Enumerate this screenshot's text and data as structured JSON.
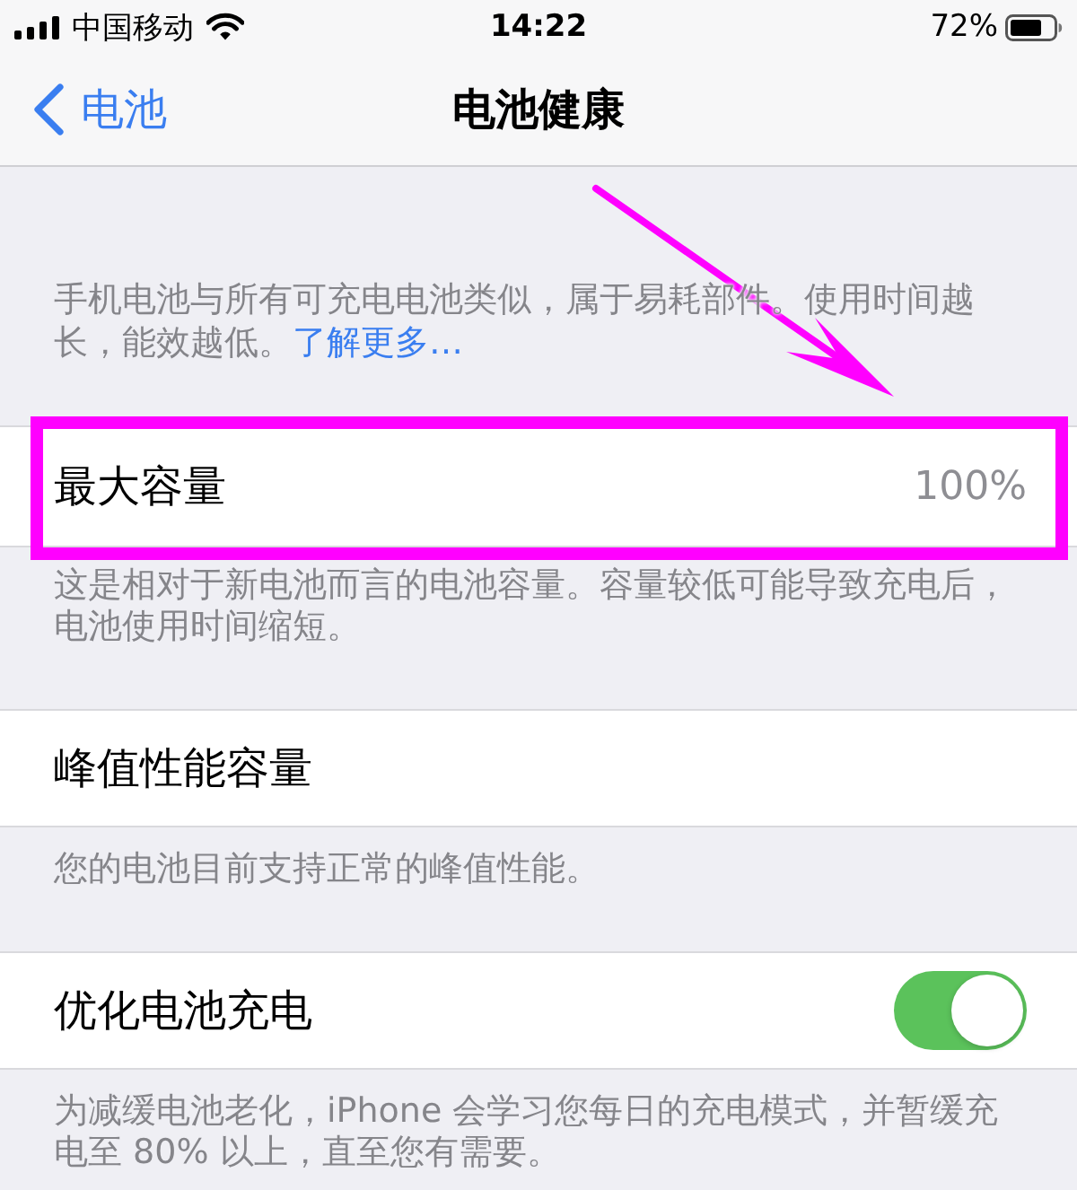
{
  "status_bar": {
    "carrier": "中国移动",
    "time": "14:22",
    "battery": "72%"
  },
  "nav_bar": {
    "back": "电池",
    "title": "电池健康"
  },
  "intro": {
    "text": "手机电池与所有可充电电池类似，属于易耗部件。使用时间越长，能效越低。",
    "link": "了解更多…"
  },
  "sections": [
    {
      "kind": "value",
      "label": "最大容量",
      "value": "100%",
      "highlighted": true,
      "footer": "这是相对于新电池而言的电池容量。容量较低可能导致充电后，电池使用时间缩短。"
    },
    {
      "kind": "plain",
      "label": "峰值性能容量",
      "highlighted": false,
      "footer": "您的电池目前支持正常的峰值性能。"
    },
    {
      "kind": "toggle",
      "label": "优化电池充电",
      "on": true,
      "highlighted": false,
      "footer": "为减缓电池老化，iPhone 会学习您每日的充电模式，并暂缓充电至 80% 以上，直至您有需要。"
    }
  ]
}
